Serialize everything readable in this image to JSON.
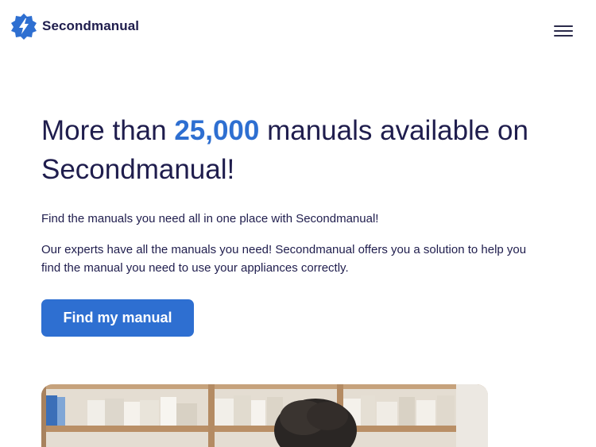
{
  "header": {
    "brand": "Secondmanual",
    "logo_icon": "lightning-gear-icon",
    "menu_icon": "hamburger-menu-icon",
    "brand_color": "#2e6fd1"
  },
  "hero": {
    "title_before": "More than ",
    "title_number": "25,000",
    "title_after": " manuals available on Secondmanual!",
    "paragraph_1": "Find the manuals you need all in one place with Secondmanual!",
    "paragraph_2": "Our experts have all the manuals you need! Secondmanual offers you a solution to help you find the manual you need to use your appliances correctly.",
    "cta_label": "Find my manual"
  },
  "image": {
    "description_icon": "person-with-bookshelf-photo"
  }
}
